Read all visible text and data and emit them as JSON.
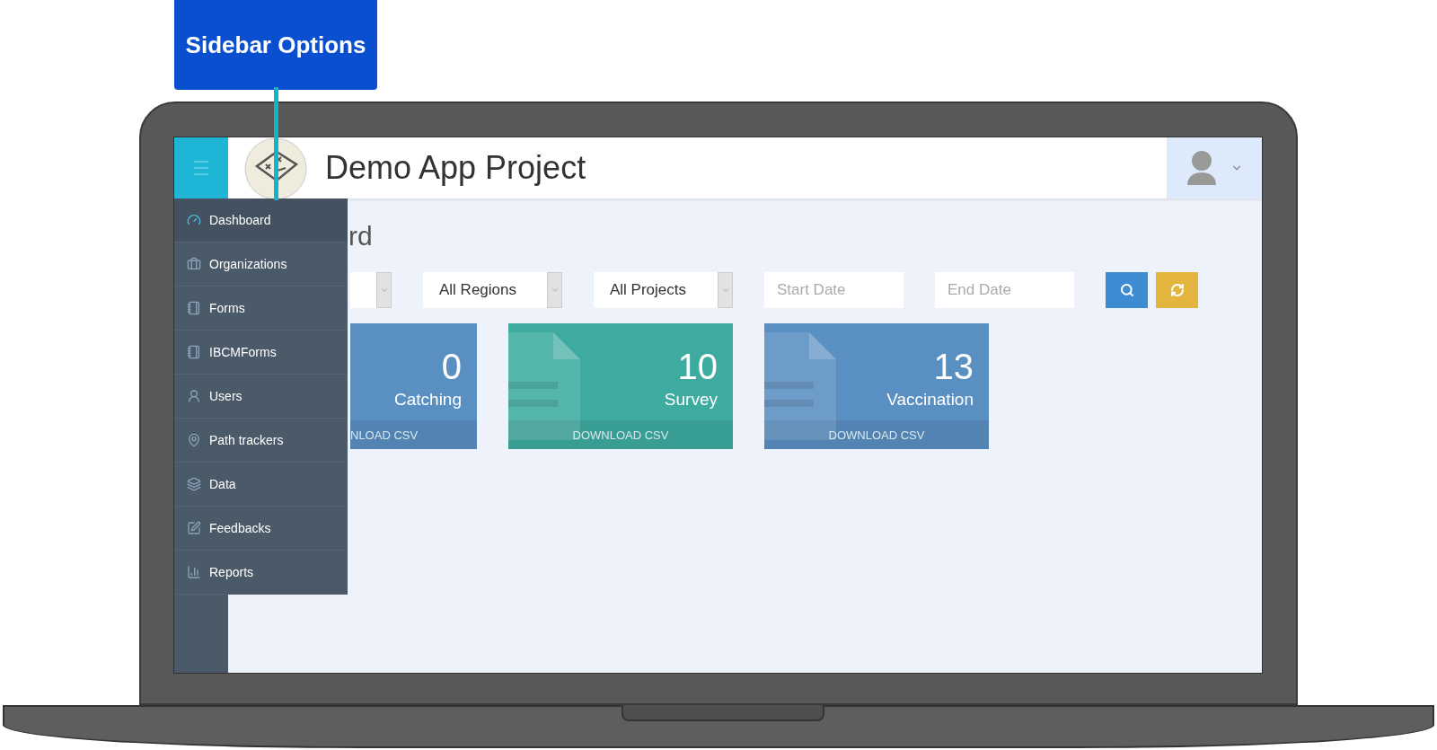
{
  "callout": {
    "label": "Sidebar Options"
  },
  "header": {
    "title": "Demo App Project"
  },
  "menu": [
    {
      "label": "Dashboard",
      "selected": true
    },
    {
      "label": "Organizations",
      "selected": false
    },
    {
      "label": "Forms",
      "selected": false
    },
    {
      "label": "IBCMForms",
      "selected": false
    },
    {
      "label": "Users",
      "selected": false
    },
    {
      "label": "Path trackers",
      "selected": false
    },
    {
      "label": "Data",
      "selected": false
    },
    {
      "label": "Feedbacks",
      "selected": false
    },
    {
      "label": "Reports",
      "selected": false
    }
  ],
  "heading": "rd",
  "filters": [
    {
      "kind": "select"
    },
    {
      "kind": "select",
      "value": "All Regions"
    },
    {
      "kind": "select",
      "value": "All Projects"
    },
    {
      "kind": "date",
      "placeholder": "Start Date"
    },
    {
      "kind": "date",
      "placeholder": "End Date"
    },
    {
      "kind": "search"
    },
    {
      "kind": "refresh"
    }
  ],
  "cards": [
    {
      "count": "0",
      "label": "Catching",
      "footer": "NLOAD CSV",
      "color": "#5a8fc2"
    },
    {
      "count": "10",
      "label": "Survey",
      "footer": "DOWNLOAD CSV",
      "color": "#3dab9f"
    },
    {
      "count": "13",
      "label": "Vaccination",
      "footer": "DOWNLOAD CSV",
      "color": "#5a8fc2"
    }
  ]
}
